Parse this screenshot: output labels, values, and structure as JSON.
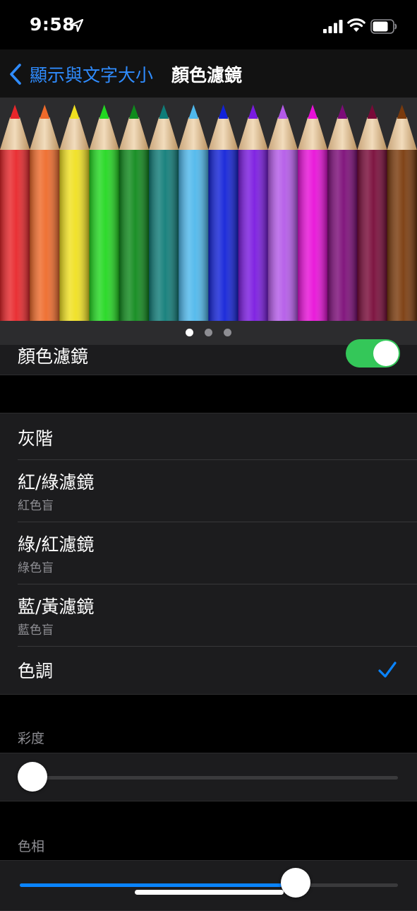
{
  "status_bar": {
    "time": "9:58"
  },
  "nav": {
    "back_label": "顯示與文字大小",
    "title": "顏色濾鏡"
  },
  "preview": {
    "pencil_colors": [
      "#e8262a",
      "#ee6a2a",
      "#f0e020",
      "#22d820",
      "#0f8a1c",
      "#0f7c78",
      "#4fb8ec",
      "#1222d8",
      "#7a1ae0",
      "#b45ae8",
      "#e810d8",
      "#7c0c78",
      "#780a38",
      "#7a3a0c"
    ],
    "page_count": 3,
    "active_page": 0
  },
  "toggle": {
    "label": "顏色濾鏡",
    "on": true
  },
  "filters": [
    {
      "title": "灰階",
      "subtitle": ""
    },
    {
      "title": "紅/綠濾鏡",
      "subtitle": "紅色盲"
    },
    {
      "title": "綠/紅濾鏡",
      "subtitle": "綠色盲"
    },
    {
      "title": "藍/黃濾鏡",
      "subtitle": "藍色盲"
    },
    {
      "title": "色調",
      "subtitle": ""
    }
  ],
  "selected_filter": "色調",
  "intensity": {
    "header": "彩度",
    "value": 0
  },
  "hue": {
    "header": "色相",
    "value": 0.73
  },
  "colors": {
    "accent": "#0a84ff",
    "toggle_on": "#34c759"
  }
}
